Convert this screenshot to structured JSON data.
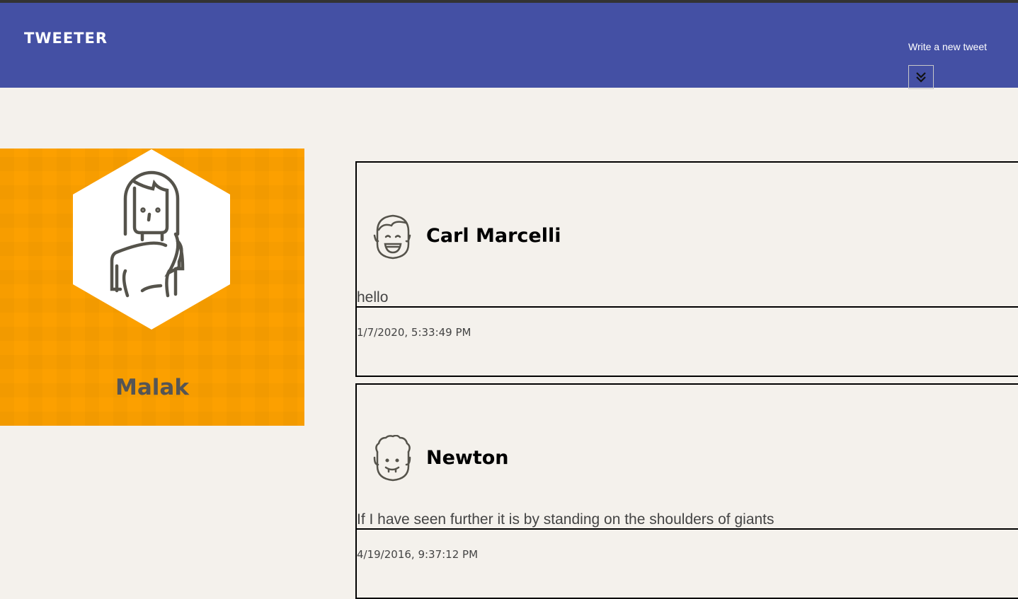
{
  "header": {
    "logo": "TWEETER",
    "write_label": "Write a new tweet",
    "toggle_icon": "double-chevron-down-icon",
    "background": "#4450a4"
  },
  "profile": {
    "name": "Malak",
    "avatar_icon": "woman-avatar-icon",
    "background": "#fca000"
  },
  "tweets": [
    {
      "author": "Carl Marcelli",
      "avatar_icon": "smiling-man-avatar-icon",
      "text": "hello",
      "date": "1/7/2020, 5:33:49 PM"
    },
    {
      "author": "Newton",
      "avatar_icon": "curly-hair-man-avatar-icon",
      "text": "If I have seen further it is by standing on the shoulders of giants",
      "date": "4/19/2016, 9:37:12 PM"
    }
  ]
}
